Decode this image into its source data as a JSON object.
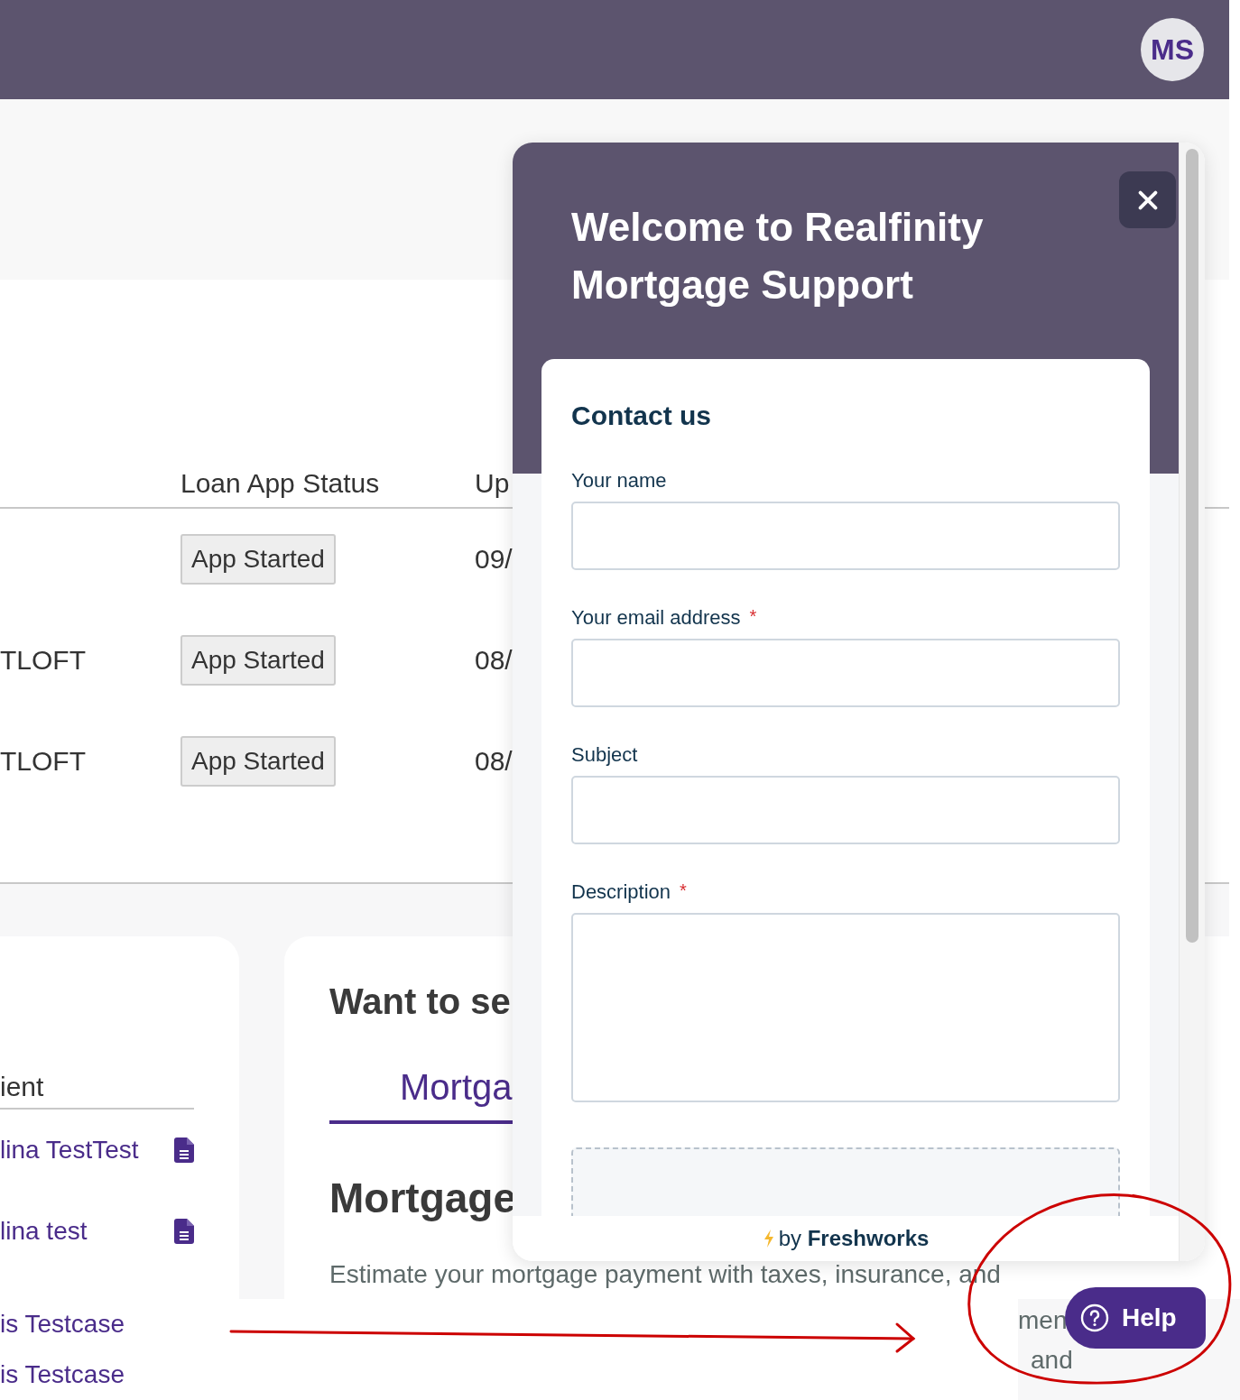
{
  "header": {
    "avatar": "MS"
  },
  "loans": {
    "columns": [
      "Loan App Status",
      "Up"
    ],
    "rows": [
      {
        "status": "App Started",
        "date": "09/"
      },
      {
        "client": "TLOFT",
        "status": "App Started",
        "date": "08/"
      },
      {
        "client": "TLOFT",
        "status": "App Started",
        "date": "08/"
      }
    ]
  },
  "clients": {
    "heading": "ient",
    "items": [
      {
        "name": "lina TestTest",
        "document": true
      },
      {
        "name": "lina test",
        "document": true
      }
    ]
  },
  "calculator": {
    "title": "Want to se",
    "tabs": [
      {
        "label": "Mortga",
        "selected": true
      }
    ],
    "heading": "Mortgage",
    "description": "Estimate your mortgage payment with taxes, insurance, and"
  },
  "lower_list": [
    "is Testcase",
    "is Testcase"
  ],
  "fragments": [
    "men",
    "and"
  ],
  "widget": {
    "title": "Welcome to Realfinity Mortgage Support",
    "form_title": "Contact us",
    "fields": [
      {
        "kind": "input",
        "label": "Your name"
      },
      {
        "kind": "input",
        "label": "Your email address",
        "required_mark": "*"
      },
      {
        "kind": "input",
        "label": "Subject"
      },
      {
        "kind": "textarea",
        "label": "Description",
        "required_mark": "*"
      },
      {
        "kind": "upload"
      }
    ],
    "footer": "by **Freshworks**"
  },
  "help_button": {
    "label": "Help"
  }
}
